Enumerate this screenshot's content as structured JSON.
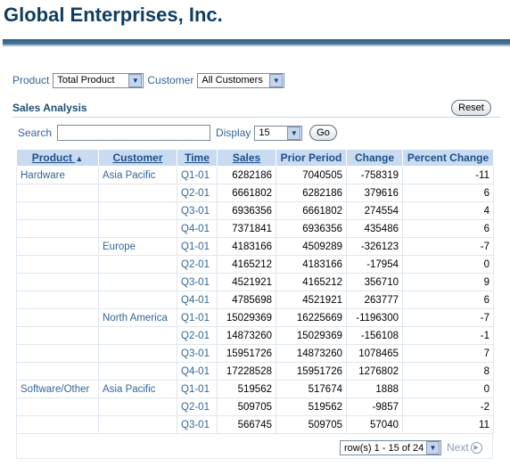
{
  "header": {
    "title": "Global Enterprises, Inc."
  },
  "filters": {
    "product_label": "Product",
    "product_value": "Total Product",
    "customer_label": "Customer",
    "customer_value": "All Customers"
  },
  "section": {
    "title": "Sales Analysis",
    "reset_label": "Reset"
  },
  "search": {
    "label": "Search",
    "value": "",
    "display_label": "Display",
    "display_value": "15",
    "go_label": "Go"
  },
  "table": {
    "headers": {
      "product": "Product",
      "sort_indicator": "▲",
      "customer": "Customer",
      "time": "Time",
      "sales": "Sales",
      "prior": "Prior Period",
      "change": "Change",
      "pct": "Percent Change"
    },
    "rows": [
      {
        "product": "Hardware",
        "customer": "Asia Pacific",
        "time": "Q1-01",
        "sales": "6282186",
        "prior": "7040505",
        "change": "-758319",
        "pct": "-11"
      },
      {
        "product": "",
        "customer": "",
        "time": "Q2-01",
        "sales": "6661802",
        "prior": "6282186",
        "change": "379616",
        "pct": "6"
      },
      {
        "product": "",
        "customer": "",
        "time": "Q3-01",
        "sales": "6936356",
        "prior": "6661802",
        "change": "274554",
        "pct": "4"
      },
      {
        "product": "",
        "customer": "",
        "time": "Q4-01",
        "sales": "7371841",
        "prior": "6936356",
        "change": "435486",
        "pct": "6"
      },
      {
        "product": "",
        "customer": "Europe",
        "time": "Q1-01",
        "sales": "4183166",
        "prior": "4509289",
        "change": "-326123",
        "pct": "-7"
      },
      {
        "product": "",
        "customer": "",
        "time": "Q2-01",
        "sales": "4165212",
        "prior": "4183166",
        "change": "-17954",
        "pct": "0"
      },
      {
        "product": "",
        "customer": "",
        "time": "Q3-01",
        "sales": "4521921",
        "prior": "4165212",
        "change": "356710",
        "pct": "9"
      },
      {
        "product": "",
        "customer": "",
        "time": "Q4-01",
        "sales": "4785698",
        "prior": "4521921",
        "change": "263777",
        "pct": "6"
      },
      {
        "product": "",
        "customer": "North America",
        "time": "Q1-01",
        "sales": "15029369",
        "prior": "16225669",
        "change": "-1196300",
        "pct": "-7"
      },
      {
        "product": "",
        "customer": "",
        "time": "Q2-01",
        "sales": "14873260",
        "prior": "15029369",
        "change": "-156108",
        "pct": "-1"
      },
      {
        "product": "",
        "customer": "",
        "time": "Q3-01",
        "sales": "15951726",
        "prior": "14873260",
        "change": "1078465",
        "pct": "7"
      },
      {
        "product": "",
        "customer": "",
        "time": "Q4-01",
        "sales": "17228528",
        "prior": "15951726",
        "change": "1276802",
        "pct": "8"
      },
      {
        "product": "Software/Other",
        "customer": "Asia Pacific",
        "time": "Q1-01",
        "sales": "519562",
        "prior": "517674",
        "change": "1888",
        "pct": "0"
      },
      {
        "product": "",
        "customer": "",
        "time": "Q2-01",
        "sales": "509705",
        "prior": "519562",
        "change": "-9857",
        "pct": "-2"
      },
      {
        "product": "",
        "customer": "",
        "time": "Q3-01",
        "sales": "566745",
        "prior": "509705",
        "change": "57040",
        "pct": "11"
      }
    ]
  },
  "pagination": {
    "range": "row(s) 1 - 15 of 24",
    "next_label": "Next"
  },
  "colors": {
    "header_bg": "#c9dbf0",
    "label_text": "#336699",
    "title": "#0f3d62"
  }
}
